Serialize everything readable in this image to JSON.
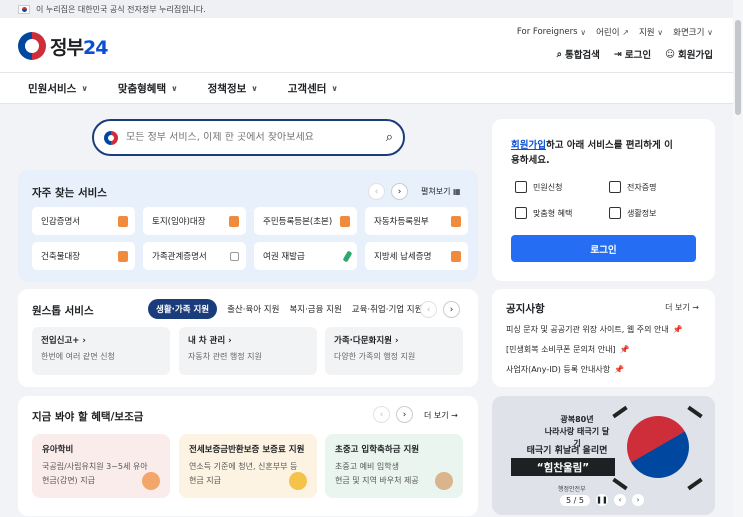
{
  "topbar": {
    "notice": "이 누리집은 대한민국 공식 전자정부 누리집입니다."
  },
  "header": {
    "logo_text": "정부",
    "logo_num": "24",
    "utils": [
      "For Foreigners",
      "어린이",
      "지원",
      "화면크기"
    ],
    "account": {
      "search": "통합검색",
      "login": "로그인",
      "join": "회원가입"
    }
  },
  "nav": {
    "items": [
      "민원서비스",
      "맞춤형혜택",
      "정책정보",
      "고객센터"
    ]
  },
  "search": {
    "placeholder": "모든 정부 서비스, 이제 한 곳에서 찾아보세요"
  },
  "frequent": {
    "title": "자주 찾는 서비스",
    "expand": "펼쳐보기",
    "items": [
      "인감증명서",
      "토지(임야)대장",
      "주민등록등본(초본)",
      "자동차등록원부",
      "건축물대장",
      "가족관계증명서",
      "여권 재발급",
      "지방세 납세증명"
    ]
  },
  "onestop": {
    "title": "원스톱 서비스",
    "tabs": [
      "생활·가족 지원",
      "출산·육아 지원",
      "복지·금융 지원",
      "교육·취업·기업 지원"
    ],
    "cards": [
      {
        "title": "전입신고+",
        "desc": "한번에 여러 같면 신청"
      },
      {
        "title": "내 차 관리",
        "desc": "자동차 관련 행정 지원"
      },
      {
        "title": "가족·다문화지원",
        "desc": "다양한 가족의 행정 지원"
      }
    ]
  },
  "benefits": {
    "title": "지금 봐야 할 혜택/보조금",
    "more": "더 보기",
    "cards": [
      {
        "title": "유아학비",
        "line1": "국공립/사립유치원 3~5세 유아",
        "line2": "현금(감면) 지급",
        "bg": "#fbecec"
      },
      {
        "title": "전세보증금반환보증 보증료 지원",
        "line1": "연소득 기준에 청년, 신혼부부 등",
        "line2": "현금 지급",
        "bg": "#fcf3e3"
      },
      {
        "title": "초중고 입학축하금 지원",
        "line1": "초중고 예비 입학생",
        "line2": "현금 및 지역 바우처 제공",
        "bg": "#e9f5ee"
      }
    ]
  },
  "login": {
    "lead_link": "회원가입",
    "lead_rest": "하고 아래 서비스를 편리하게 이용하세요.",
    "services": [
      "민원신청",
      "전자증명",
      "맞춤형 혜택",
      "생활정보"
    ],
    "button": "로그인"
  },
  "notice": {
    "title": "공지사항",
    "more": "더 보기",
    "items": [
      "피싱 문자 및 공공기관 위장 사이트, 웹 주의 안내",
      "[민생회복 소비쿠폰 문의처 안내]",
      "사업자(Any-ID) 등록 안내사항"
    ]
  },
  "banner": {
    "line1": "광복80년",
    "line2": "나라사랑 태극기 달기",
    "line3": "태극기 휘날려 올리면",
    "line4": "“힘찬울림”",
    "ministry": "행정안전부",
    "pager": "5 / 5"
  },
  "colors": {
    "primary": "#256ef4",
    "navy": "#1b3c7a",
    "freq_bg": "#e8f0fb"
  }
}
